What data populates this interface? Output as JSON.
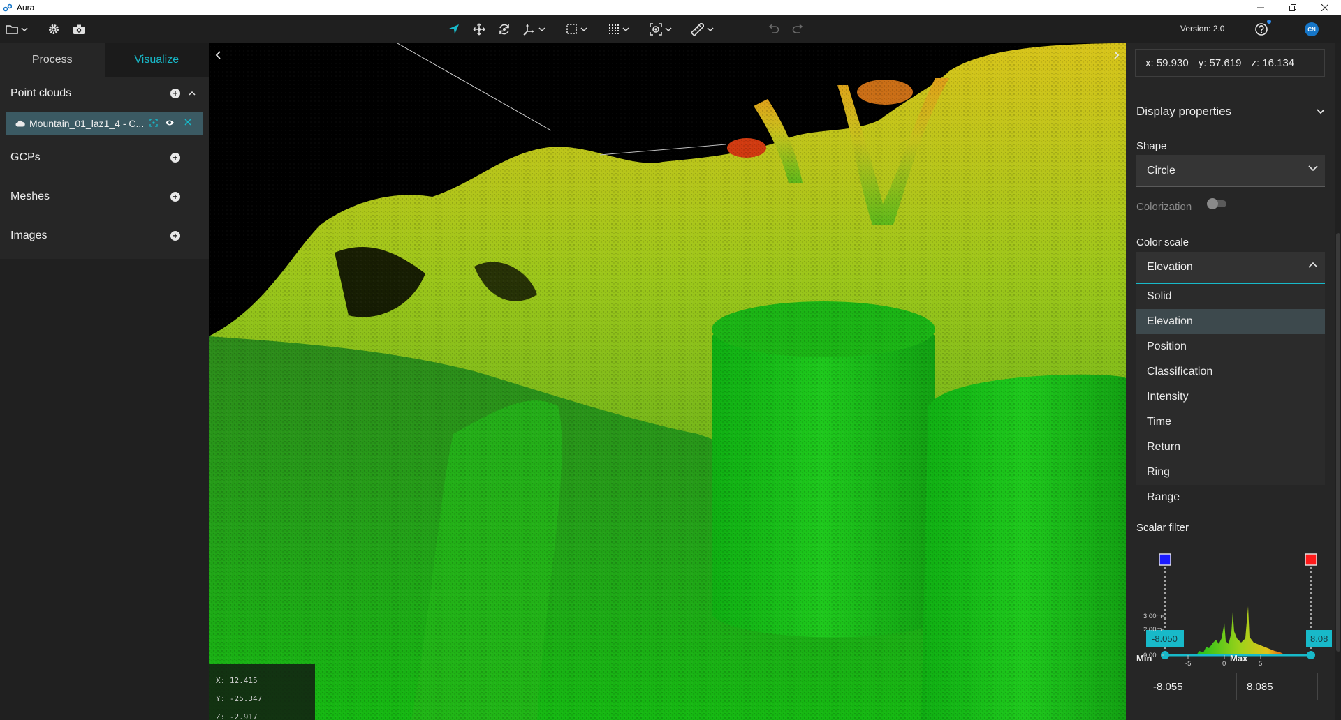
{
  "app": {
    "title": "Aura",
    "version": "Version: 2.0",
    "avatar_initials": "CN"
  },
  "left": {
    "tabs": [
      "Process",
      "Visualize"
    ],
    "sections": {
      "point_clouds": "Point clouds",
      "gcps": "GCPs",
      "meshes": "Meshes",
      "images": "Images"
    },
    "point_cloud_item": "Mountain_01_laz1_4 - C..."
  },
  "viewport": {
    "cursor": {
      "x": "X: 12.415",
      "y": "Y: -25.347",
      "z": "Z: -2.917"
    }
  },
  "right": {
    "xyz": {
      "x": "x: 59.930",
      "y": "y: 57.619",
      "z": "z: 16.134"
    },
    "display_properties": "Display properties",
    "shape_label": "Shape",
    "shape_value": "Circle",
    "colorization_label": "Colorization",
    "colorization_on": false,
    "color_scale_label": "Color scale",
    "color_scale_value": "Elevation",
    "color_scale_options": [
      "Solid",
      "Elevation",
      "Position",
      "Classification",
      "Intensity",
      "Time",
      "Return",
      "Ring",
      "Range"
    ],
    "scalar_filter_label": "Scalar filter",
    "histogram": {
      "y_ticks": [
        "3.00m",
        "2.00m",
        "0.00"
      ],
      "x_ticks": [
        "-5",
        "0",
        "5"
      ],
      "low_handle": "-8.050",
      "high_handle": "8.08"
    },
    "min_label": "Min",
    "max_label": "Max",
    "min_value": "-8.055",
    "max_value": "8.085",
    "colors": {
      "accent": "#18b9c9",
      "low_marker": "#1a1aff",
      "high_marker": "#ff1a1a"
    }
  }
}
